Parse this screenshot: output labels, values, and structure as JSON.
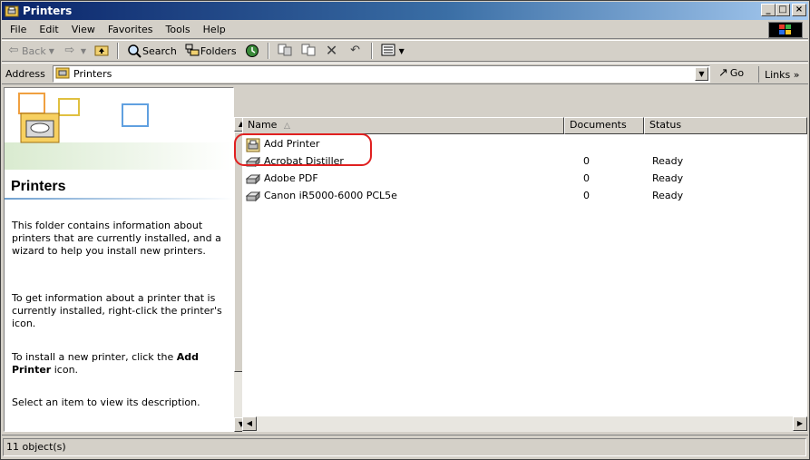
{
  "window": {
    "title": "Printers"
  },
  "window_buttons": {
    "minimize": "_",
    "maximize": "□",
    "close": "×"
  },
  "menu": [
    {
      "label": "File"
    },
    {
      "label": "Edit"
    },
    {
      "label": "View"
    },
    {
      "label": "Favorites"
    },
    {
      "label": "Tools"
    },
    {
      "label": "Help"
    }
  ],
  "toolbar": {
    "back": "Back",
    "search": "Search",
    "folders": "Folders"
  },
  "address": {
    "label": "Address",
    "value": "Printers",
    "go": "Go",
    "links": "Links »"
  },
  "left_pane": {
    "title": "Printers",
    "para1": "This folder contains information about printers that are currently installed, and a wizard to help you install new printers.",
    "para2": "To get information about a printer that is currently installed, right-click the printer's icon.",
    "para3_prefix": "To install a new printer, click the ",
    "para3_bold": "Add Printer",
    "para3_suffix": " icon.",
    "para4": "Select an item to view its description."
  },
  "columns": {
    "name": "Name",
    "documents": "Documents",
    "status": "Status"
  },
  "items": [
    {
      "name": "Add Printer",
      "documents": "",
      "status": ""
    },
    {
      "name": "Acrobat Distiller",
      "documents": "0",
      "status": "Ready"
    },
    {
      "name": "Adobe PDF",
      "documents": "0",
      "status": "Ready"
    },
    {
      "name": "Canon iR5000-6000 PCL5e",
      "documents": "0",
      "status": "Ready"
    }
  ],
  "status_bar": {
    "text": "11 object(s)"
  },
  "colors": {
    "title_start": "#0a246a",
    "title_end": "#a6caf0",
    "highlight": "#e02020",
    "face": "#d4d0c8"
  }
}
